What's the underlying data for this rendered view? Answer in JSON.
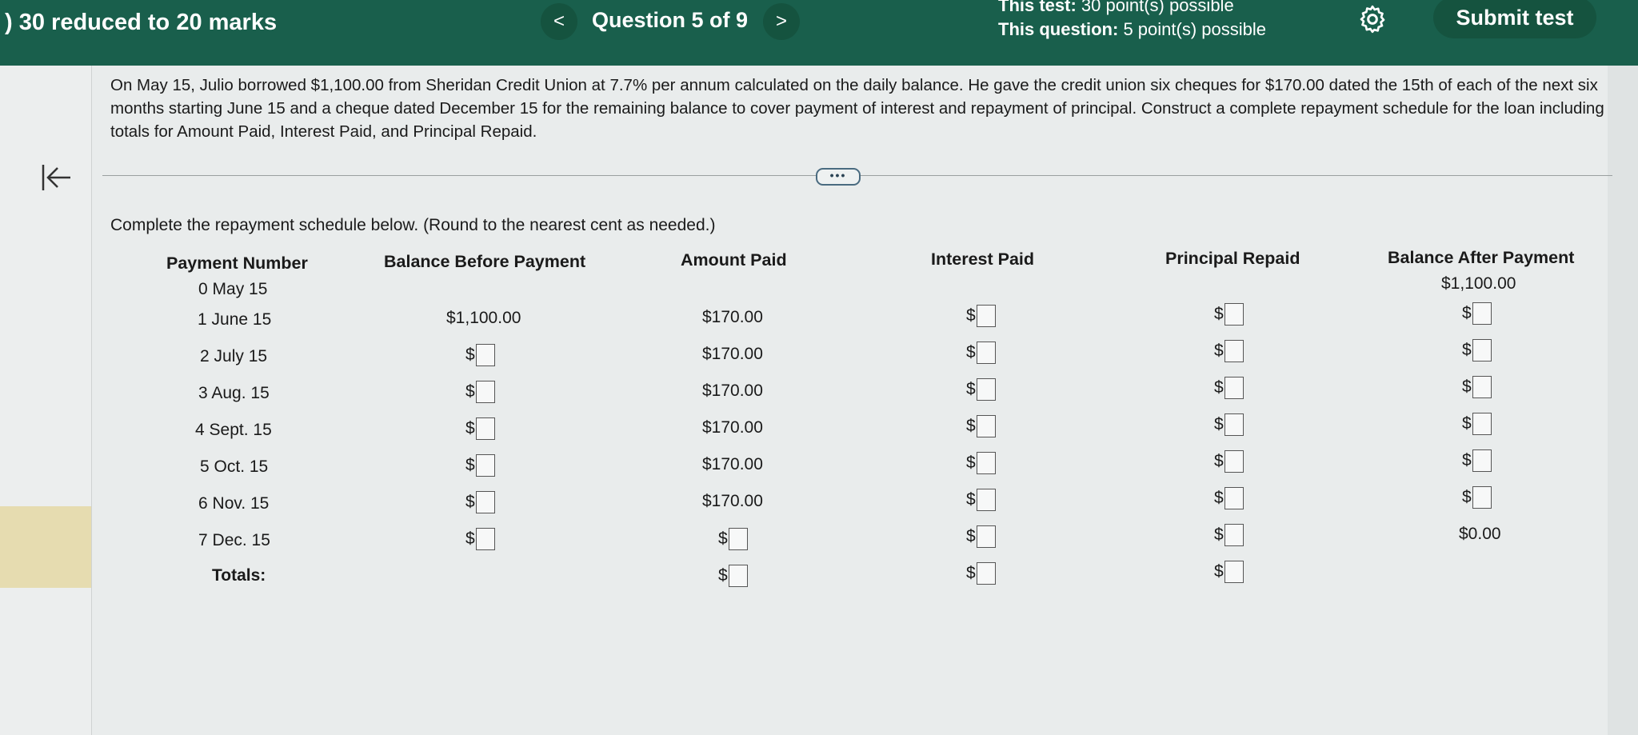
{
  "header": {
    "marks_title": ") 30 reduced to 20 marks",
    "prev_label": "<",
    "question_label": "Question 5 of 9",
    "next_label": ">",
    "test_points_bold": "This test:",
    "test_points_rest": " 30 point(s) possible",
    "question_points_bold": "This question:",
    "question_points_rest": " 5 point(s) possible",
    "submit_label": "Submit test"
  },
  "question": {
    "text": "On May 15, Julio borrowed $1,100.00 from Sheridan Credit Union at 7.7% per annum calculated on the daily balance. He gave the credit union six cheques for $170.00 dated the 15th of each of the next six months starting June 15 and a cheque dated December 15 for the remaining balance to cover payment of interest and repayment of principal. Construct a complete repayment schedule for the loan including totals for Amount Paid, Interest Paid, and Principal Repaid.",
    "more_label": "•••",
    "instruction": "Complete the repayment schedule below. (Round to the nearest cent as needed.)"
  },
  "table": {
    "headers": {
      "payment_number": "Payment Number",
      "balance_before": "Balance Before Payment",
      "amount_paid": "Amount Paid",
      "interest_paid": "Interest Paid",
      "principal_repaid": "Principal Repaid",
      "balance_after": "Balance After Payment"
    },
    "rows": [
      {
        "num": "0",
        "date": "May 15",
        "balance_after": "$1,100.00"
      },
      {
        "num": "1",
        "date": "June 15",
        "balance_before": "$1,100.00",
        "amount_paid": "$170.00"
      },
      {
        "num": "2",
        "date": "July 15",
        "amount_paid": "$170.00"
      },
      {
        "num": "3",
        "date": "Aug. 15",
        "amount_paid": "$170.00"
      },
      {
        "num": "4",
        "date": "Sept. 15",
        "amount_paid": "$170.00"
      },
      {
        "num": "5",
        "date": "Oct. 15",
        "amount_paid": "$170.00"
      },
      {
        "num": "6",
        "date": "Nov. 15",
        "amount_paid": "$170.00"
      },
      {
        "num": "7",
        "date": "Dec. 15",
        "balance_after": "$0.00"
      }
    ],
    "totals_label": "Totals:",
    "dollar_sign": "$"
  }
}
